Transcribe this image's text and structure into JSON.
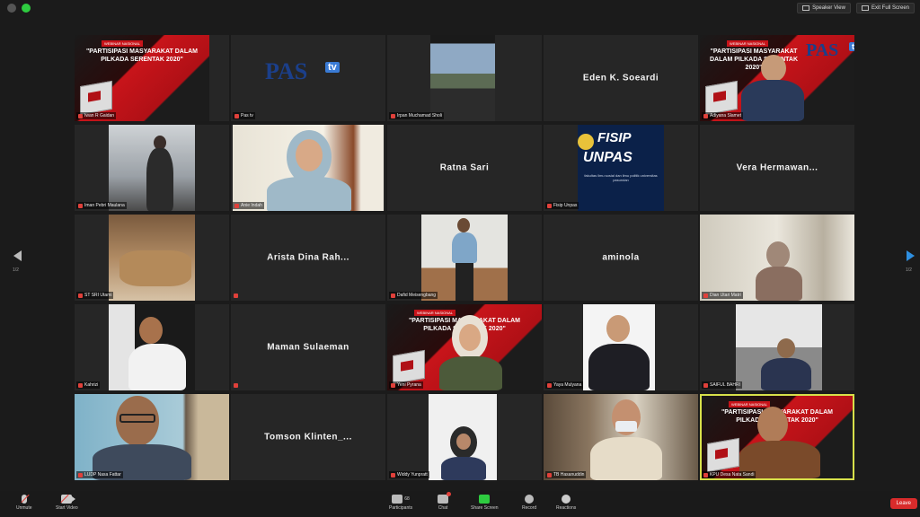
{
  "window": {
    "actions": [
      {
        "label": "Speaker View",
        "icon": "speaker-view-icon"
      },
      {
        "label": "Exit Full Screen",
        "icon": "exit-fullscreen-icon"
      }
    ]
  },
  "pagination": {
    "left": "1/2",
    "right": "1/2"
  },
  "banner": {
    "tag": "WEBINAR NASIONAL",
    "title_a": "\"PARTISIPASI MASYARAKAT DALAM PILKADA SERENTAK 2020\"",
    "title_b": "\"PARTISIPASI MASYARAKAT DALAM PILKADA SERENTAK 2020\""
  },
  "logos": {
    "pas": "PAS",
    "tv": "tv",
    "fisip_line1": "FISIP",
    "fisip_line2": "UNPAS",
    "fisip_sub": "fakultas ilmu sosial dan ilmu politik universitas pasundan"
  },
  "participants": [
    {
      "label": "Iwan R Gaidan"
    },
    {
      "label": "Pas tv"
    },
    {
      "label": "Irpan Muchamad Sholi"
    },
    {
      "name": "Eden K. Soeardi"
    },
    {
      "label": "Adiyana Slamet"
    },
    {
      "label": "Iman Pebri Maulana"
    },
    {
      "label": "Anie Indah"
    },
    {
      "name": "Ratna Sari"
    },
    {
      "label": "Fisip Unpas"
    },
    {
      "name": "Vera Hermawan..."
    },
    {
      "label": "ST SRI Utami"
    },
    {
      "name": "Arista Dina Rah..."
    },
    {
      "label": "Dafid Meisengbang"
    },
    {
      "name": "aminola"
    },
    {
      "label": "Dian Utari Matri"
    },
    {
      "label": "Kahrizi"
    },
    {
      "name": "Maman Sulaeman"
    },
    {
      "label": "Yeni Pyrana"
    },
    {
      "label": "Yaya Mulyana"
    },
    {
      "label": "SAIFUL BAHRI"
    },
    {
      "label": "LUDP Nasa Fattar"
    },
    {
      "name": "Tomson Klinten_..."
    },
    {
      "label": "Widdy Yunpratt"
    },
    {
      "label": "TB Hasanuddin"
    },
    {
      "label": "KPU Desa Nata Sandi"
    }
  ],
  "toolbar": {
    "unmute": "Unmute",
    "start_video": "Start Video",
    "participants": "Participants",
    "participants_count": "68",
    "chat": "Chat",
    "share": "Share Screen",
    "record": "Record",
    "reactions": "Reactions",
    "leave": "Leave"
  }
}
